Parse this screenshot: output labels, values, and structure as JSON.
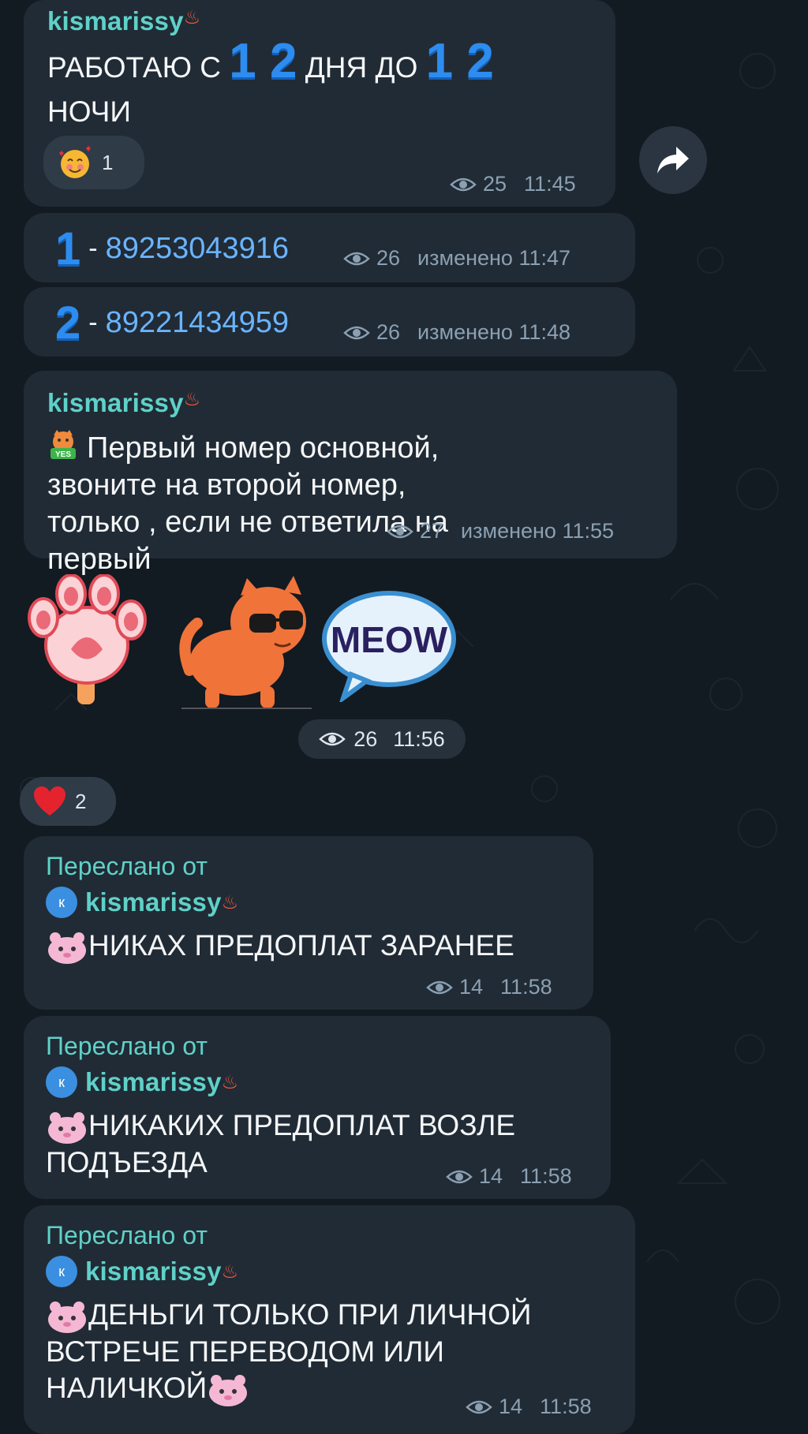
{
  "sender": "kismarissy",
  "msg1": {
    "text_a": "РАБОТАЮ С",
    "num_a": "1 2",
    "text_b": "ДНЯ ДО",
    "num_b": "1 2",
    "text_c": "НОЧИ",
    "reaction_count": "1",
    "views": "25",
    "time": "11:45"
  },
  "msg2": {
    "num": "1",
    "dash": "-",
    "phone": "89253043916",
    "views": "26",
    "edited": "изменено 11:47"
  },
  "msg3": {
    "num": "2",
    "dash": "-",
    "phone": "89221434959",
    "views": "26",
    "edited": "изменено 11:48"
  },
  "msg4": {
    "badge": "YES",
    "text": "Первый номер основной, звоните на второй номер, только , если не ответила на первый",
    "views": "27",
    "edited": "изменено 11:55"
  },
  "stickers": {
    "meow_text": "MEOW",
    "views": "26",
    "time": "11:56",
    "reaction_count": "2"
  },
  "forwarded_label": "Переслано от",
  "avatar_letter": "к",
  "fwd1": {
    "text": "НИКАХ ПРЕДОПЛАТ ЗАРАНЕЕ",
    "views": "14",
    "time": "11:58"
  },
  "fwd2": {
    "text_line1": "НИКАКИХ ПРЕДОПЛАТ ВОЗЛЕ",
    "text_line2": "ПОДЪЕЗДА",
    "views": "14",
    "time": "11:58"
  },
  "fwd3": {
    "text_line1": "ДЕНЬГИ ТОЛЬКО ПРИ ЛИЧНОЙ",
    "text_line2": "ВСТРЕЧЕ ПЕРЕВОДОМ  ИЛИ",
    "text_line3": "НАЛИЧКОЙ",
    "views": "14",
    "time": "11:58"
  },
  "colors": {
    "background": "#121a22",
    "bubble": "#212b35",
    "sender": "#5fd1c8",
    "phone_link": "#6ab4ff",
    "meta": "#8ba0b2"
  },
  "icons": [
    "eye-icon",
    "share-icon",
    "heart-icon",
    "smiling-face-with-hearts-icon",
    "hamster-icon",
    "fire-icon"
  ]
}
